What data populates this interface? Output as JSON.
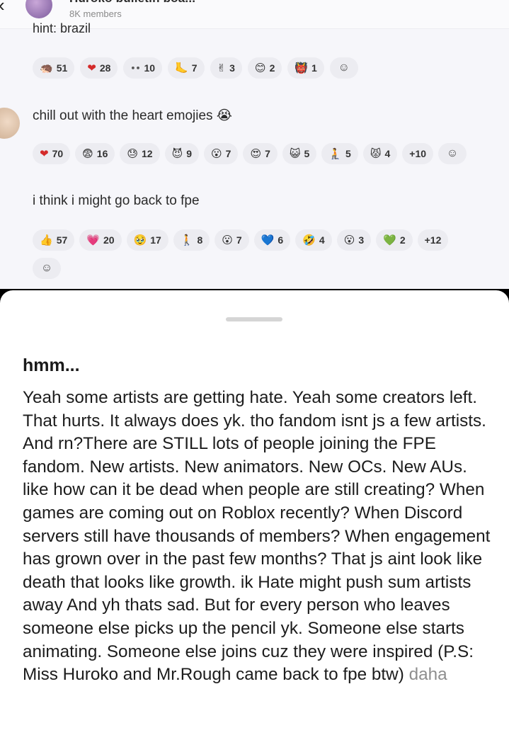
{
  "group": {
    "name": "Huroko bulletin boa...",
    "members": "8K members"
  },
  "messages": [
    {
      "text": "hint: brazil",
      "reactions": [
        {
          "emoji": "🦔",
          "count": "51"
        },
        {
          "emoji": "❤",
          "count": "28"
        },
        {
          "emoji": "••",
          "count": "10"
        },
        {
          "emoji": "🦶",
          "count": "7"
        },
        {
          "emoji": "✌",
          "count": "3"
        },
        {
          "emoji": "😊",
          "count": "2"
        },
        {
          "emoji": "👹",
          "count": "1"
        }
      ]
    },
    {
      "text": "chill out with the heart emojies 😭",
      "reactions": [
        {
          "emoji": "❤",
          "count": "70"
        },
        {
          "emoji": "😨",
          "count": "16"
        },
        {
          "emoji": "😓",
          "count": "12"
        },
        {
          "emoji": "😈",
          "count": "9"
        },
        {
          "emoji": "😮",
          "count": "7"
        },
        {
          "emoji": "😍",
          "count": "7"
        },
        {
          "emoji": "😺",
          "count": "5"
        },
        {
          "emoji": "🧎",
          "count": "5"
        },
        {
          "emoji": "😾",
          "count": "4"
        }
      ],
      "more": "+10"
    },
    {
      "text": "i think i might go back to fpe",
      "reactions": [
        {
          "emoji": "👍",
          "count": "57"
        },
        {
          "emoji": "💗",
          "count": "20"
        },
        {
          "emoji": "🥹",
          "count": "17"
        },
        {
          "emoji": "🚶",
          "count": "8"
        },
        {
          "emoji": "😮",
          "count": "7"
        },
        {
          "emoji": "💙",
          "count": "6"
        },
        {
          "emoji": "🤣",
          "count": "4"
        },
        {
          "emoji": "😮",
          "count": "3"
        },
        {
          "emoji": "💚",
          "count": "2"
        }
      ],
      "more": "+12"
    }
  ],
  "add_reaction_icon": "smiley-plus-icon",
  "post": {
    "title": "hmm...",
    "body": "Yeah some artists are getting hate. Yeah some creators left. That hurts. It always does yk. tho fandom isnt js a few artists. And rn?There are STILL lots of people joining the FPE fandom. New artists. New animators. New OCs. New AUs. like how can it be dead when people are still creating? When games are coming out on Roblox recently? When Discord servers still have thousands of members? When engagement has grown over in the past few months? That js aint look like death that looks like growth. ik Hate might push sum artists away And yh thats sad. But for every person who leaves someone else picks up the pencil yk. Someone else starts animating. Someone else joins cuz they were inspired (P.S: Miss Huroko and Mr.Rough came back to fpe btw)",
    "more_label": "daha"
  }
}
